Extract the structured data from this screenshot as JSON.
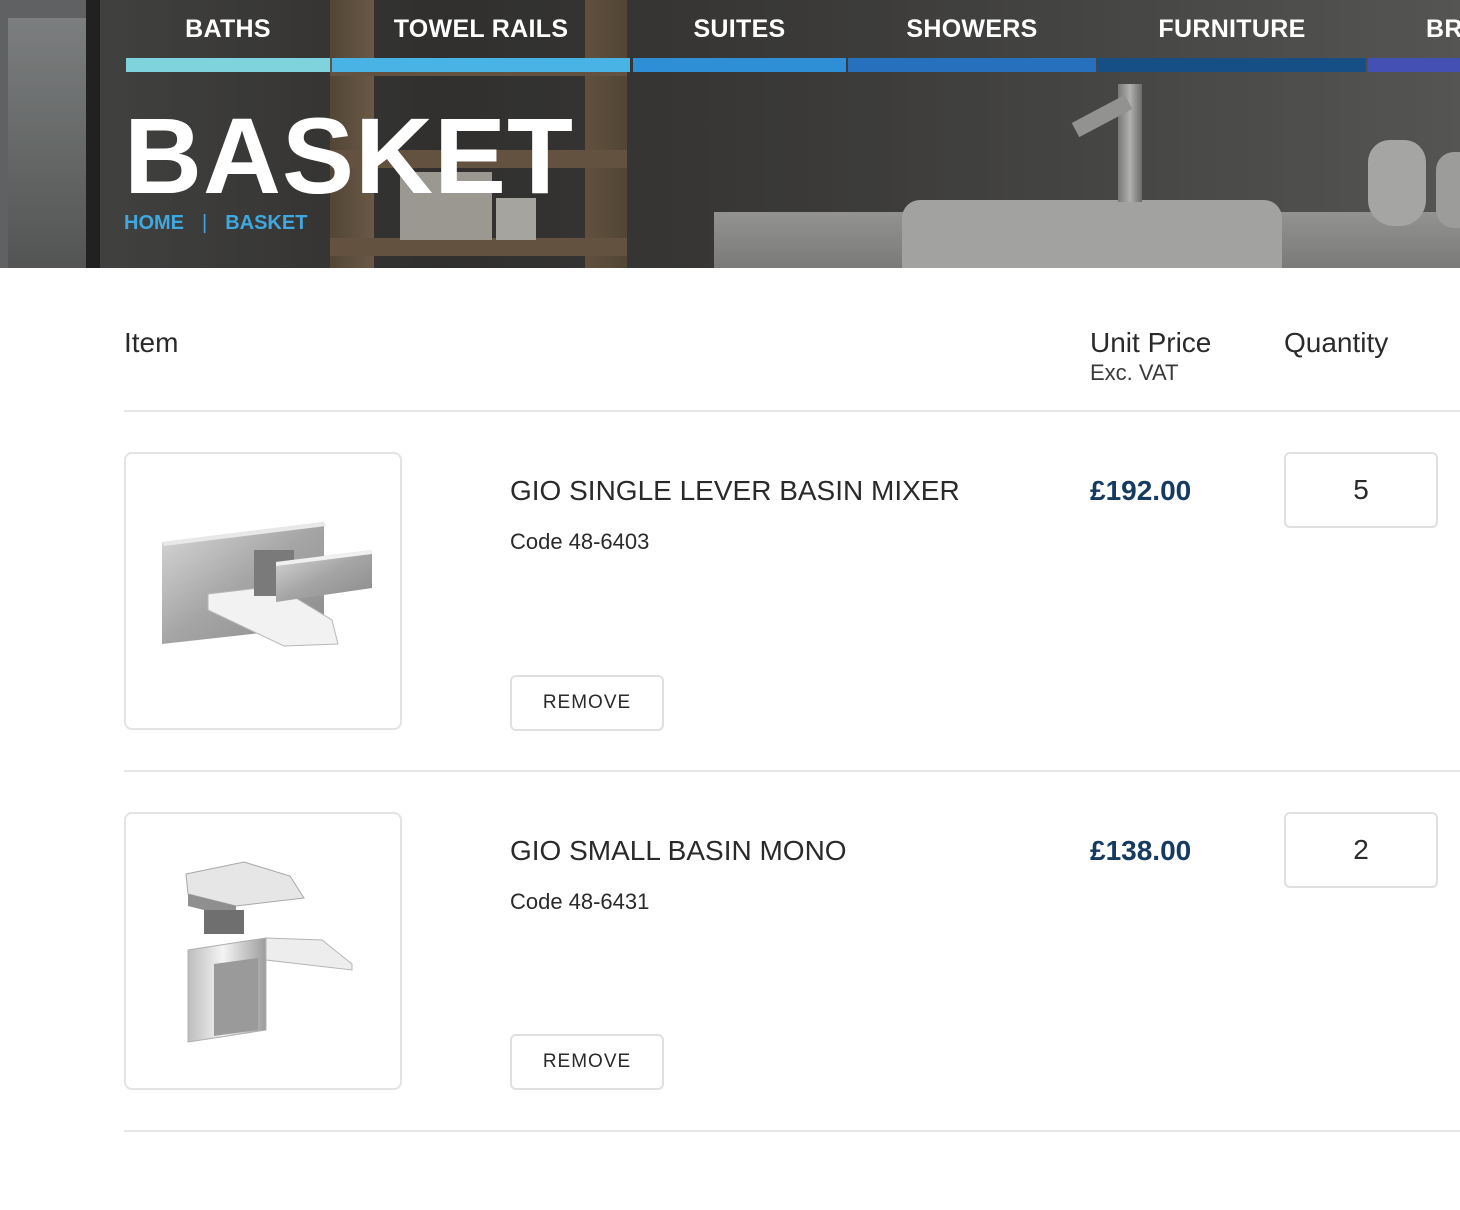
{
  "nav": {
    "items": [
      {
        "label": "BATHS",
        "color": "#7fd3dc"
      },
      {
        "label": "TOWEL RAILS",
        "color": "#4ab3e6"
      },
      {
        "label": "SUITES",
        "color": "#2f8fd6"
      },
      {
        "label": "SHOWERS",
        "color": "#2770be"
      },
      {
        "label": "FURNITURE",
        "color": "#154f86"
      },
      {
        "label": "BR",
        "color": "#4550b4"
      }
    ]
  },
  "page": {
    "title": "BASKET",
    "breadcrumb": {
      "home": "HOME",
      "separator": "|",
      "current": "BASKET"
    }
  },
  "table": {
    "headers": {
      "item": "Item",
      "unit_price": "Unit Price",
      "unit_price_note": "Exc. VAT",
      "quantity": "Quantity"
    },
    "rows": [
      {
        "name": "GIO SINGLE LEVER BASIN MIXER",
        "code_label": "Code",
        "code": "48-6403",
        "price": "£192.00",
        "quantity": "5",
        "remove_label": "REMOVE",
        "image_icon": "wall-basin-mixer-image"
      },
      {
        "name": "GIO SMALL BASIN MONO",
        "code_label": "Code",
        "code": "48-6431",
        "price": "£138.00",
        "quantity": "2",
        "remove_label": "REMOVE",
        "image_icon": "basin-mono-tap-image"
      }
    ]
  },
  "colors": {
    "price": "#163b60",
    "breadcrumb": "#3fa8e0"
  }
}
